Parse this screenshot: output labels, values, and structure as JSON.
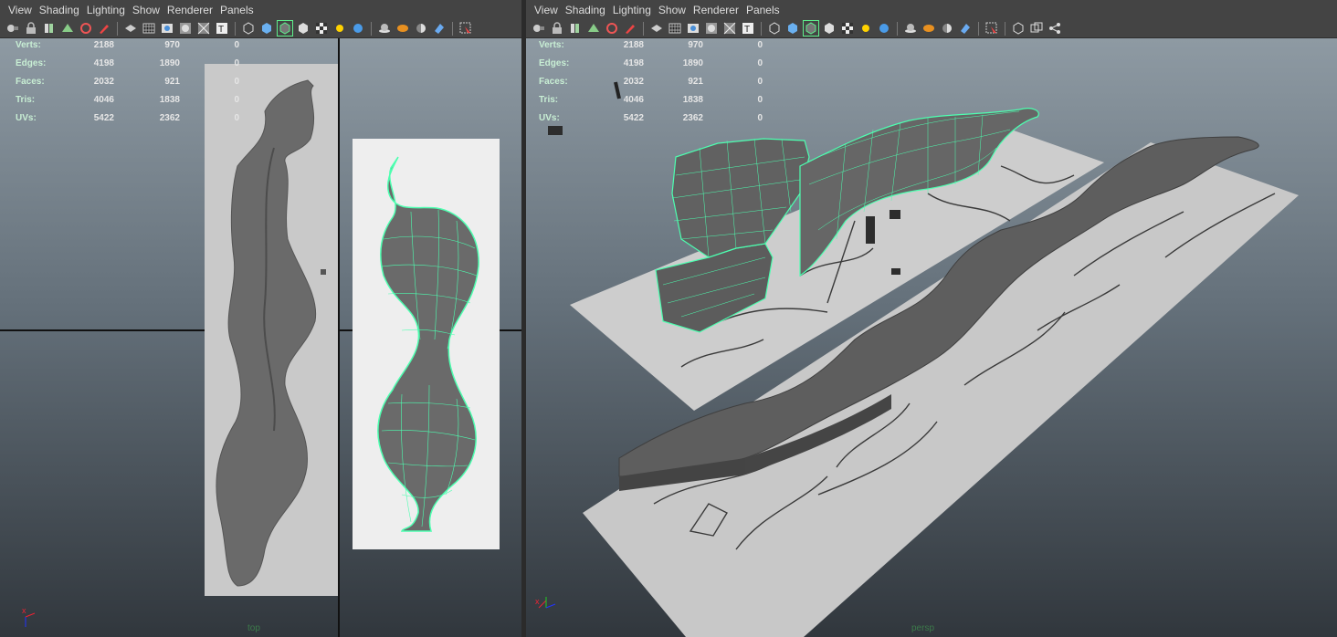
{
  "menu": [
    "View",
    "Shading",
    "Lighting",
    "Show",
    "Renderer",
    "Panels"
  ],
  "hud_labels": [
    "Verts:",
    "Edges:",
    "Faces:",
    "Tris:",
    "UVs:"
  ],
  "hud_rows": [
    [
      "2188",
      "970",
      "0"
    ],
    [
      "4198",
      "1890",
      "0"
    ],
    [
      "2032",
      "921",
      "0"
    ],
    [
      "4046",
      "1838",
      "0"
    ],
    [
      "5422",
      "2362",
      "0"
    ]
  ],
  "left_view": {
    "camera": "top"
  },
  "right_view": {
    "camera": "persp"
  },
  "axis_labels": {
    "x": "x",
    "y": "y",
    "z": "z"
  },
  "colors": {
    "wire": "#4dffb0",
    "mesh": "#6e6e6e",
    "plane": "#cfcfcf",
    "grid": "#111111"
  },
  "toolbar_icons": [
    "select-camera-icon",
    "lock-camera-icon",
    "bookmarks-icon",
    "image-plane-icon",
    "camera-attributes-icon",
    "snapshot-icon",
    "grease-pencil-icon",
    "xray-icon",
    "grid-icon",
    "film-gate-icon",
    "resolution-gate-icon",
    "gate-mask-icon",
    "field-chart-icon",
    "safe-action-icon",
    "wireframe-icon",
    "smooth-shade-icon",
    "wireframe-on-shaded-icon",
    "default-material-icon",
    "textured-icon",
    "use-all-lights-icon",
    "shadows-icon",
    "ambient-occlusion-icon",
    "antialias-icon",
    "depth-of-field-icon",
    "isolate-select-icon",
    "hud-icon"
  ]
}
